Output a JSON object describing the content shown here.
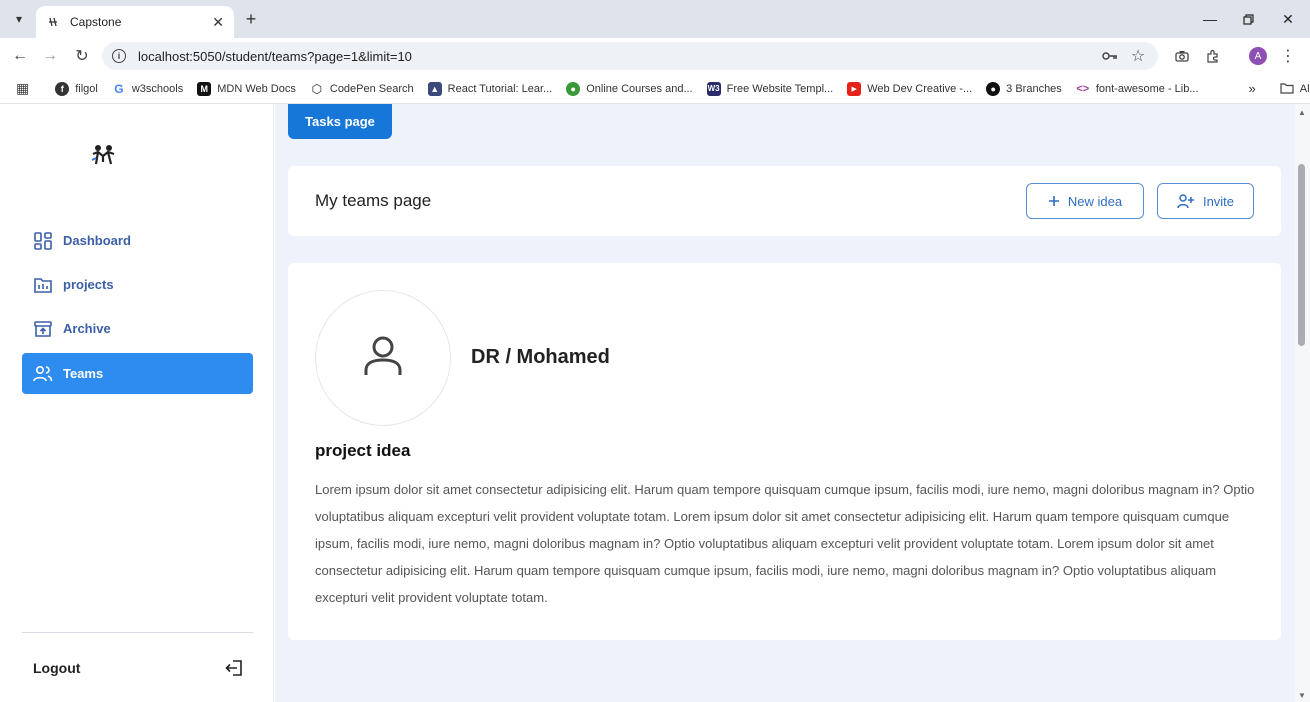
{
  "browser": {
    "tab_title": "Capstone",
    "url": "localhost:5050/student/teams?page=1&limit=10",
    "avatar_letter": "A",
    "bookmarks": [
      {
        "label": "filgol",
        "icon": "filgol-icon",
        "color": "#333333"
      },
      {
        "label": "w3schools",
        "icon": "google-icon",
        "color": "#4285f4"
      },
      {
        "label": "MDN Web Docs",
        "icon": "mdn-icon",
        "color": "#111111"
      },
      {
        "label": "CodePen Search",
        "icon": "codepen-icon",
        "color": "#222222"
      },
      {
        "label": "React Tutorial: Lear...",
        "icon": "react-tutorial-icon",
        "color": "#3b4a7a"
      },
      {
        "label": "Online Courses and...",
        "icon": "courses-icon",
        "color": "#3a9a3a"
      },
      {
        "label": "Free Website Templ...",
        "icon": "w3-icon",
        "color": "#2b2b6b"
      },
      {
        "label": "Web Dev Creative -...",
        "icon": "youtube-icon",
        "color": "#e62117"
      },
      {
        "label": "3 Branches",
        "icon": "github-icon",
        "color": "#111111"
      },
      {
        "label": "font-awesome - Lib...",
        "icon": "code-icon",
        "color": "#9a3c9a"
      }
    ],
    "all_bookmarks": "All Bookmarks"
  },
  "sidebar": {
    "items": [
      {
        "label": "Dashboard",
        "icon": "dashboard-icon"
      },
      {
        "label": "projects",
        "icon": "projects-icon"
      },
      {
        "label": "Archive",
        "icon": "archive-icon"
      },
      {
        "label": "Teams",
        "icon": "teams-icon"
      }
    ],
    "active": "Teams",
    "logout": "Logout"
  },
  "main": {
    "tasks_button": "Tasks page",
    "header_title": "My teams page",
    "new_idea_button": "New idea",
    "invite_button": "Invite",
    "doctor_name": "DR / Mohamed",
    "idea_heading": "project idea",
    "idea_text": "Lorem ipsum dolor sit amet consectetur adipisicing elit. Harum quam tempore quisquam cumque ipsum, facilis modi, iure nemo, magni doloribus magnam in? Optio voluptatibus aliquam excepturi velit provident voluptate totam. Lorem ipsum dolor sit amet consectetur adipisicing elit. Harum quam tempore quisquam cumque ipsum, facilis modi, iure nemo, magni doloribus magnam in? Optio voluptatibus aliquam excepturi velit provident voluptate totam. Lorem ipsum dolor sit amet consectetur adipisicing elit. Harum quam tempore quisquam cumque ipsum, facilis modi, iure nemo, magni doloribus magnam in? Optio voluptatibus aliquam excepturi velit provident voluptate totam."
  },
  "colors": {
    "accent": "#2e8cf0",
    "primary_button": "#1677d8",
    "main_bg": "#eef3fb"
  }
}
